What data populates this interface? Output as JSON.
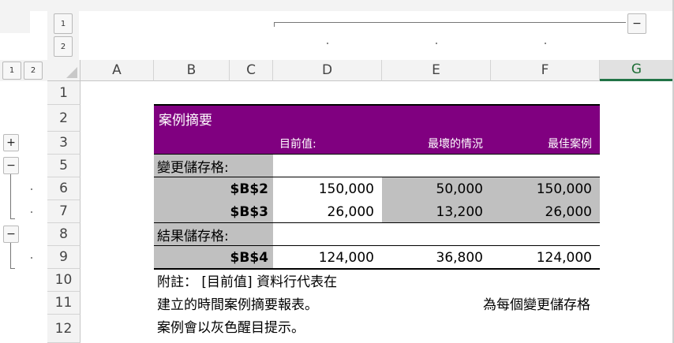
{
  "outline": {
    "row_levels": [
      "1",
      "2"
    ],
    "col_levels": [
      "1",
      "2"
    ],
    "collapse_symbol": "−",
    "expand_symbol": "+"
  },
  "columns": [
    "A",
    "B",
    "C",
    "D",
    "E",
    "F",
    "G"
  ],
  "selected_column": "G",
  "rows": [
    "1",
    "2",
    "3",
    "5",
    "6",
    "7",
    "8",
    "9",
    "10",
    "11",
    "12"
  ],
  "sheet": {
    "title": "案例摘要",
    "headers": {
      "current": "目前值:",
      "worst": "最壞的情況",
      "best": "最佳案例"
    },
    "changing_label": "變更儲存格:",
    "changing": [
      {
        "ref": "$B$2",
        "current": "150,000",
        "worst": "50,000",
        "best": "150,000"
      },
      {
        "ref": "$B$3",
        "current": "26,000",
        "worst": "13,200",
        "best": "26,000"
      }
    ],
    "result_label": "結果儲存格:",
    "result": {
      "ref": "$B$4",
      "current": "124,000",
      "worst": "36,800",
      "best": "124,000"
    },
    "notes": {
      "line1": "附註：  [目前值] 資料行代表在",
      "line2": "建立的時間案例摘要報表。",
      "line2_right": "為每個變更儲存格",
      "line3": "案例會以灰色醒目提示。"
    }
  },
  "colors": {
    "header_purple": "#800080",
    "shade": "#c0c0c0",
    "selected_green": "#217346"
  }
}
